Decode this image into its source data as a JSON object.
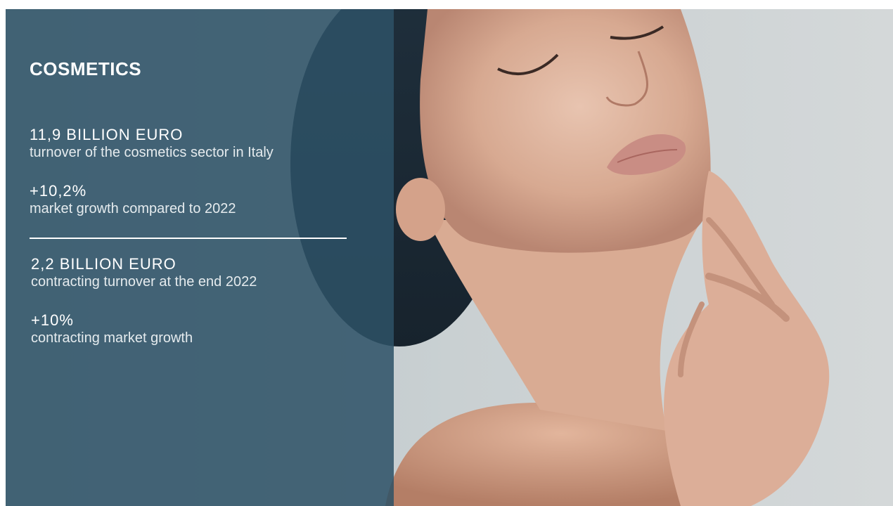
{
  "slide": {
    "title": "COSMETICS",
    "stats": [
      {
        "value": "11,9 BILLION EURO",
        "description": "turnover of the cosmetics sector in Italy"
      },
      {
        "value": "+10,2%",
        "description": "market growth compared to 2022"
      },
      {
        "value": "2,2 BILLION EURO",
        "description": "contracting turnover at the end 2022"
      },
      {
        "value": "+10%",
        "description": "contracting market growth"
      }
    ]
  },
  "colors": {
    "overlay": "#2d5266",
    "text": "#ffffff",
    "background": "#c9d0d2"
  },
  "image": {
    "subject": "woman-face-skincare-photo"
  }
}
